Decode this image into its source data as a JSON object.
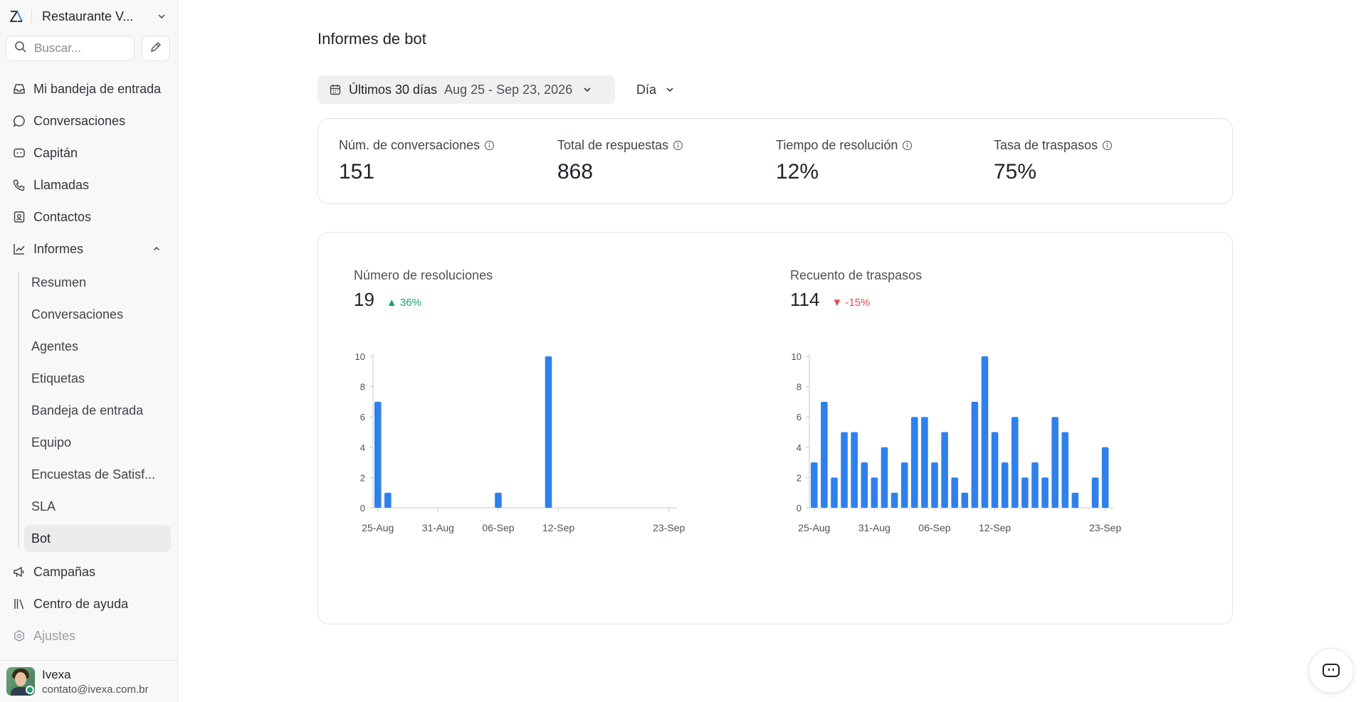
{
  "workspace": {
    "name": "Restaurante V...",
    "logo_icon": "zendesk-logo-icon"
  },
  "search": {
    "placeholder": "Buscar..."
  },
  "sidebar": {
    "items": [
      {
        "label": "Mi bandeja de entrada",
        "icon": "inbox-icon"
      },
      {
        "label": "Conversaciones",
        "icon": "chat-bubble-icon"
      },
      {
        "label": "Capitán",
        "icon": "bot-icon"
      },
      {
        "label": "Llamadas",
        "icon": "phone-icon"
      },
      {
        "label": "Contactos",
        "icon": "contact-card-icon"
      },
      {
        "label": "Informes",
        "icon": "chart-line-icon"
      }
    ],
    "report_subitems": [
      "Resumen",
      "Conversaciones",
      "Agentes",
      "Etiquetas",
      "Bandeja de entrada",
      "Equipo",
      "Encuestas de Satisf...",
      "SLA",
      "Bot"
    ],
    "active_subitem": "Bot",
    "bottom_items": [
      {
        "label": "Campañas",
        "icon": "megaphone-icon"
      },
      {
        "label": "Centro de ayuda",
        "icon": "library-icon"
      },
      {
        "label": "Ajustes",
        "icon": "settings-icon"
      }
    ]
  },
  "user": {
    "name": "Ivexa",
    "email": "contato@ivexa.com.br"
  },
  "page": {
    "title": "Informes de bot"
  },
  "filters": {
    "range_label": "Últimos 30 días",
    "range_dates": "Aug 25 - Sep 23, 2026",
    "granularity": "Día"
  },
  "metrics": [
    {
      "label": "Núm. de conversaciones",
      "value": "151"
    },
    {
      "label": "Total de respuestas",
      "value": "868"
    },
    {
      "label": "Tiempo de resolución",
      "value": "12%"
    },
    {
      "label": "Tasa de traspasos",
      "value": "75%"
    }
  ],
  "colors": {
    "bar": "#2f80ed",
    "up": "#1f9d77",
    "down": "#e5484d"
  },
  "chart_data": [
    {
      "type": "bar",
      "title": "Número de resoluciones",
      "total": "19",
      "change": "▲ 36%",
      "trend": "up",
      "x_tick_labels": [
        "25-Aug",
        "31-Aug",
        "06-Sep",
        "12-Sep",
        "23-Sep"
      ],
      "x_tick_index": [
        0,
        6,
        12,
        18,
        29
      ],
      "ylim": [
        0,
        10
      ],
      "y_ticks": [
        "0",
        "2",
        "4",
        "6",
        "8",
        "10"
      ],
      "values": [
        7,
        1,
        0,
        0,
        0,
        0,
        0,
        0,
        0,
        0,
        0,
        0,
        1,
        0,
        0,
        0,
        0,
        10,
        0,
        0,
        0,
        0,
        0,
        0,
        0,
        0,
        0,
        0,
        0,
        0
      ]
    },
    {
      "type": "bar",
      "title": "Recuento de traspasos",
      "total": "114",
      "change": "▼ -15%",
      "trend": "down",
      "x_tick_labels": [
        "25-Aug",
        "31-Aug",
        "06-Sep",
        "12-Sep",
        "23-Sep"
      ],
      "x_tick_index": [
        0,
        6,
        12,
        18,
        29
      ],
      "ylim": [
        0,
        10
      ],
      "y_ticks": [
        "0",
        "2",
        "4",
        "6",
        "8",
        "10"
      ],
      "values": [
        3,
        7,
        2,
        5,
        5,
        3,
        2,
        4,
        1,
        3,
        6,
        6,
        3,
        5,
        2,
        1,
        7,
        10,
        5,
        3,
        6,
        2,
        3,
        2,
        6,
        5,
        1,
        0,
        2,
        4
      ]
    }
  ]
}
